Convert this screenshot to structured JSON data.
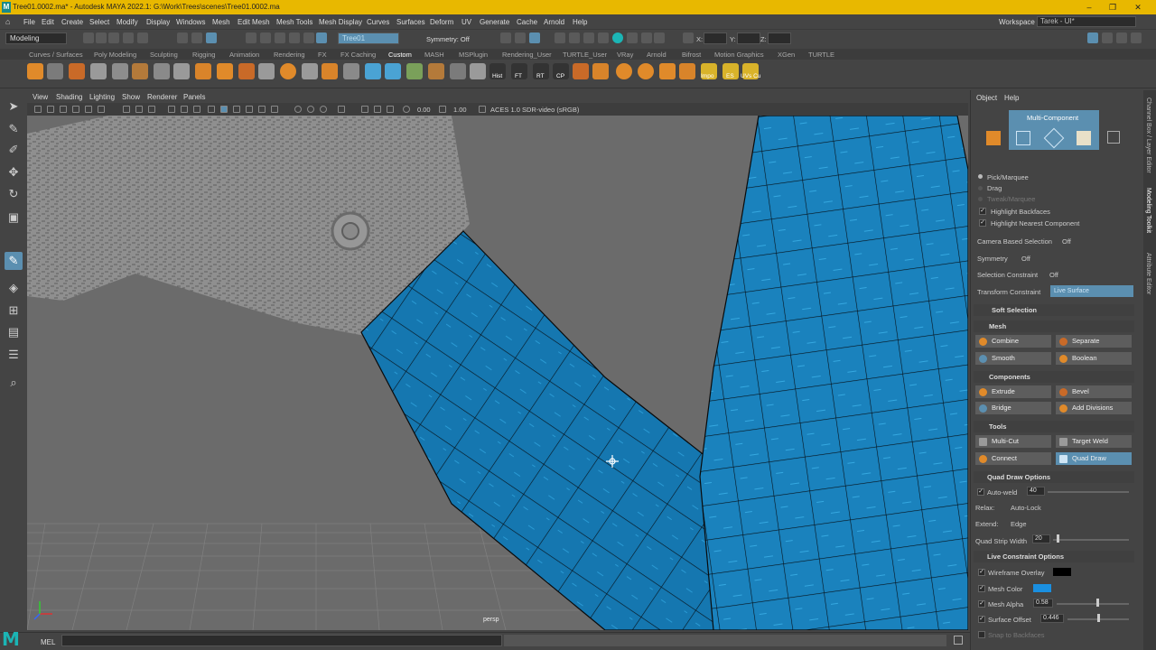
{
  "window": {
    "title": "Tree01.0002.ma* - Autodesk MAYA 2022.1: G:\\Work\\Trees\\scenes\\Tree01.0002.ma"
  },
  "menu": [
    "File",
    "Edit",
    "Create",
    "Select",
    "Modify",
    "Display",
    "Windows",
    "Mesh",
    "Edit Mesh",
    "Mesh Tools",
    "Mesh Display",
    "Curves",
    "Surfaces",
    "Deform",
    "UV",
    "Generate",
    "Cache",
    "Arnold",
    "Help"
  ],
  "workspace": {
    "label": "Workspace :",
    "value": "Tarek - UI*"
  },
  "status": {
    "mode": "Modeling",
    "live_object": "Tree01",
    "symmetry": "Symmetry: Off",
    "x_label": "X:",
    "y_label": "Y:",
    "z_label": "Z:"
  },
  "shelf_tabs": [
    "Curves / Surfaces",
    "Poly Modeling",
    "Sculpting",
    "Rigging",
    "Animation",
    "Rendering",
    "FX",
    "FX Caching",
    "Custom",
    "MASH",
    "MSPlugin",
    "Rendering_User",
    "TURTLE_User",
    "VRay",
    "Arnold",
    "Bifrost",
    "Motion Graphics",
    "XGen",
    "TURTLE"
  ],
  "shelf_labels": [
    "Hist",
    "FT",
    "RT",
    "CP",
    "Impo",
    "ES",
    "UVs Cu"
  ],
  "panel_menu": [
    "View",
    "Shading",
    "Lighting",
    "Show",
    "Renderer",
    "Panels"
  ],
  "panel_bar": {
    "exposure": "0.00",
    "gamma": "1.00",
    "colorspace": "ACES 1.0 SDR-video (sRGB)"
  },
  "viewport": {
    "camera": "persp"
  },
  "command": {
    "lang": "MEL"
  },
  "toolkit": {
    "menu": [
      "Object",
      "Help"
    ],
    "mode": "Multi-Component",
    "pick_modes": [
      "Pick/Marquee",
      "Drag",
      "Tweak/Marquee"
    ],
    "highlight_backfaces": "Highlight Backfaces",
    "highlight_nearest": "Highlight Nearest Component",
    "camera_based": {
      "label": "Camera Based Selection",
      "value": "Off"
    },
    "symmetry": {
      "label": "Symmetry",
      "value": "Off"
    },
    "selection_constraint": {
      "label": "Selection Constraint",
      "value": "Off"
    },
    "transform_constraint": {
      "label": "Transform Constraint",
      "value": "Live Surface"
    },
    "sections": {
      "soft": "Soft Selection",
      "mesh": "Mesh",
      "components": "Components",
      "tools": "Tools",
      "quad_draw": "Quad Draw Options",
      "live": "Live Constraint Options"
    },
    "mesh_buttons": [
      "Combine",
      "Separate",
      "Smooth",
      "Boolean"
    ],
    "component_buttons": [
      "Extrude",
      "Bevel",
      "Bridge",
      "Add Divisions"
    ],
    "tool_buttons": [
      "Multi-Cut",
      "Target Weld",
      "Connect",
      "Quad Draw"
    ],
    "quad": {
      "auto_weld": "Auto-weld",
      "auto_weld_value": "40",
      "relax_label": "Relax:",
      "relax_value": "Auto-Lock",
      "extend_label": "Extend:",
      "extend_value": "Edge",
      "strip_label": "Quad Strip Width",
      "strip_value": "20"
    },
    "live": {
      "wire": "Wireframe Overlay",
      "mesh_color": "Mesh Color",
      "alpha": "Mesh Alpha",
      "alpha_value": "0.58",
      "offset": "Surface Offset",
      "offset_value": "0.446",
      "snap": "Snap to Backfaces"
    },
    "side_tabs": [
      "Channel Box / Layer Editor",
      "Modeling Toolkit",
      "Attribute Editor"
    ]
  },
  "colors": {
    "accent": "#5b8fb0",
    "mesh_color": "#1a8fe0",
    "wireframe": "#000000",
    "title_bar": "#e8b800"
  }
}
